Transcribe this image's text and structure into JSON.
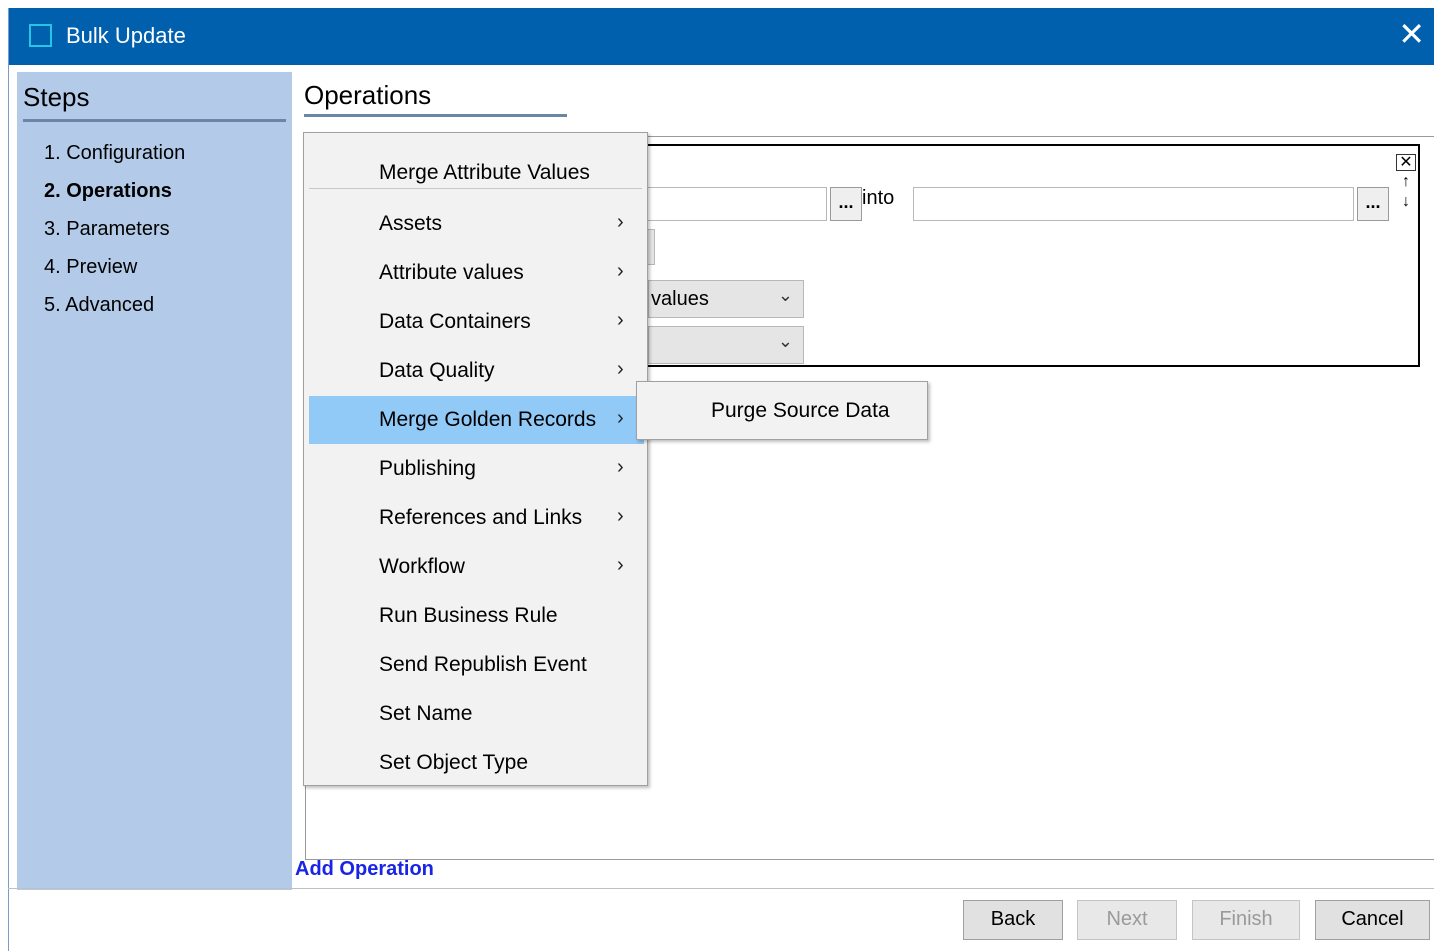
{
  "window": {
    "title": "Bulk Update",
    "close_glyph": "✕"
  },
  "steps": {
    "title": "Steps",
    "items": [
      {
        "label": "1. Configuration",
        "active": false
      },
      {
        "label": "2. Operations",
        "active": true
      },
      {
        "label": "3. Parameters",
        "active": false
      },
      {
        "label": "4. Preview",
        "active": false
      },
      {
        "label": "5. Advanced",
        "active": false
      }
    ]
  },
  "operations": {
    "title": "Operations",
    "into_label": "into",
    "dots_label": "...",
    "combo1_text": "values",
    "combo2_text": "",
    "add_operation": "Add Operation"
  },
  "context_menu": {
    "items": [
      {
        "label": "Merge Attribute Values",
        "submenu": false
      },
      {
        "label": "Assets",
        "submenu": true
      },
      {
        "label": "Attribute values",
        "submenu": true
      },
      {
        "label": "Data Containers",
        "submenu": true
      },
      {
        "label": "Data Quality",
        "submenu": true
      },
      {
        "label": "Merge Golden Records",
        "submenu": true,
        "highlighted": true
      },
      {
        "label": "Publishing",
        "submenu": true
      },
      {
        "label": "References and Links",
        "submenu": true
      },
      {
        "label": "Workflow",
        "submenu": true
      },
      {
        "label": "Run Business Rule",
        "submenu": false
      },
      {
        "label": "Send Republish Event",
        "submenu": false
      },
      {
        "label": "Set Name",
        "submenu": false
      },
      {
        "label": "Set Object Type",
        "submenu": false
      }
    ],
    "arrow_glyph": "›"
  },
  "submenu": {
    "items": [
      "Purge Source Data"
    ]
  },
  "footer": {
    "back": "Back",
    "next": "Next",
    "finish": "Finish",
    "cancel": "Cancel",
    "next_enabled": false,
    "finish_enabled": false
  }
}
